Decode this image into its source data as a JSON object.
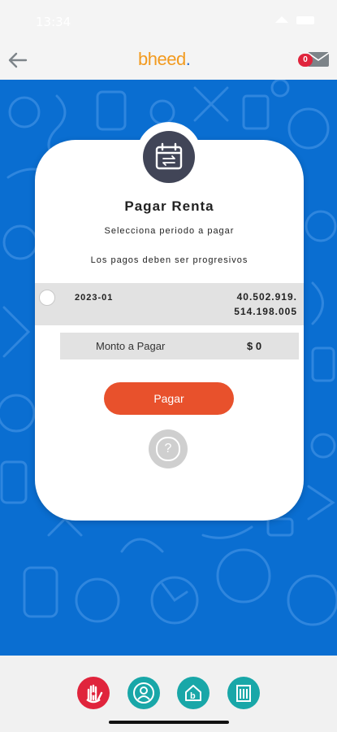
{
  "status_bar": {
    "time": "13:34"
  },
  "header": {
    "logo_b": "b",
    "logo_rest": "heed",
    "logo_dot": ".",
    "notification_count": "0",
    "icons": [
      "back-arrow-icon",
      "mail-icon"
    ]
  },
  "card": {
    "icon": "calendar-transfer-icon",
    "title": "Pagar Renta",
    "subtitle": "Selecciona periodo a pagar",
    "note": "Los pagos deben ser progresivos",
    "period": {
      "label": "2023-01",
      "amount_line1": "40.502.919.",
      "amount_line2": "514.198.005",
      "selected": false
    },
    "monto": {
      "label": "Monto a Pagar",
      "value": "$ 0"
    },
    "pay_button": "Pagar",
    "help_icon": "question-icon"
  },
  "bottom_nav": {
    "items": [
      {
        "icon": "hand-heart-icon",
        "color": "#e0243c"
      },
      {
        "icon": "person-support-icon",
        "color": "#19a7a8"
      },
      {
        "icon": "bheed-house-icon",
        "color": "#19a7a8"
      },
      {
        "icon": "building-icon",
        "color": "#19a7a8"
      }
    ]
  },
  "colors": {
    "background_blue": "#0a6ed1",
    "accent_orange": "#e8512c",
    "icon_dark": "#414557",
    "teal": "#19a7a8"
  }
}
